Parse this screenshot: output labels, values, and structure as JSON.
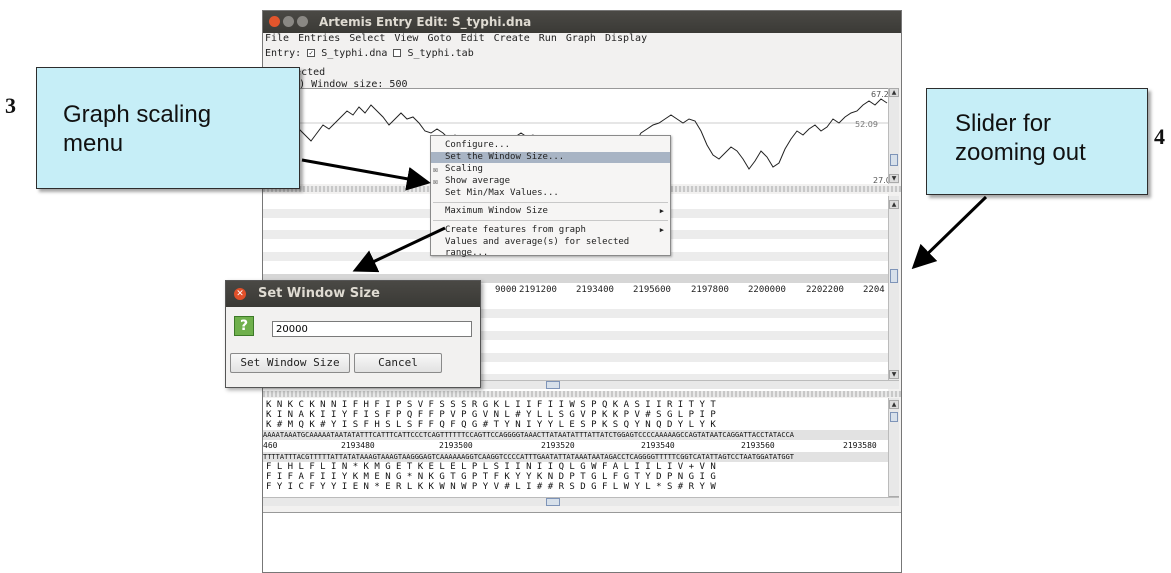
{
  "window": {
    "title": "Artemis Entry Edit: S_typhi.dna",
    "menus": [
      "File",
      "Entries",
      "Select",
      "View",
      "Goto",
      "Edit",
      "Create",
      "Run",
      "Graph",
      "Display"
    ],
    "entry_label": "Entry:",
    "entries": [
      {
        "name": "S_typhi.dna",
        "checked": true
      },
      {
        "name": "S_typhi.tab",
        "checked": false
      }
    ],
    "selection_info": "selected",
    "graph_label": "ent (%)  Window size: 500",
    "graph_values": {
      "max": "67.2",
      "avg": "52.09",
      "min": "27.0"
    },
    "ruler": [
      "9000",
      "2191200",
      "2193400",
      "2195600",
      "2197800",
      "2200000",
      "2202200",
      "2204"
    ],
    "seq_ruler": [
      "2193480",
      "2193500",
      "2193520",
      "2193540",
      "2193560",
      "2193580"
    ],
    "seq_ruler_left": "460",
    "frames_forward": [
      "K  N  K  C  K  N  N  I  F  H  F  I  P  S  V  F  S  S  S  R  G  K  L  I  I  F  I  I  W  S  P  Q  K  A  S  I  I  R  I  T  Y  T",
      " K  I  N  A  K  I  I  Y  F  I  S  F  P  Q  F  F  P  V  P  G  V  N  L  #  Y  L  L  S  G  V  P  K  K  P  V  #  S  G  L  P  I  P",
      "  K  #  M  Q  K  #  Y  I  S  F  H  S  L  S  F  F  Q  F  Q  G  #  T  Y  N  I  Y  Y  L  E  S  P  K  S  Q  Y  N  Q  D  Y  L  Y  K"
    ],
    "dna_forward": "AAAATAAATGCAAAAATAATATATTTCATTTCATTCCCTCAGTTTTTTCCAGTTCCAGGGGTAAACTTATAATATTTATTATCTGGAGTCCCCAAAAAGCCAGTATAATCAGGATTACCTATACCA",
    "dna_reverse": "TTTTATTTACGTTTTTATTATATAAAGTAAAGTAAGGGAGTCAAAAAAGGTCAAGGTCCCCATTTGAATATTATAAATAATAGACCTCAGGGGTTTTTCGGTCATATTAGTCCTAATGGATATGGT",
    "frames_reverse": [
      "   F  L  H  L  F  L  I  N  *  K  M  G  E  T  K  E  L  E  L  P  L  S  I  I  N  I  I  Q  L  G  W  F  A  L  I  I  L  I  V  +  V  N",
      "F  I  F  A  F  I  I  Y  K  M  E  N  G  *  N  K  G  T  G  P  T  F  K  Y  Y  K  N  D  P  T  G  L  F  G  T  Y  D  P  N  G  I  G",
      " F  Y  I  C  F  Y  Y  I  E  N  *  E  R  L  K  K  W  N  W  P  Y  V  #  L  I  #  #  R  S  D  G  F  L  W  Y  L  *  S  #  R  Y  W"
    ]
  },
  "popup_menu": {
    "items": [
      {
        "label": "Configure...",
        "check": "",
        "submenu": false,
        "highlighted": false
      },
      {
        "label": "Set the Window Size...",
        "check": "",
        "submenu": false,
        "highlighted": true
      },
      {
        "label": "Scaling",
        "check": "☒",
        "submenu": false,
        "highlighted": false
      },
      {
        "label": "Show average",
        "check": "☒",
        "submenu": false,
        "highlighted": false
      },
      {
        "label": "Set Min/Max Values...",
        "check": "",
        "submenu": false,
        "highlighted": false
      },
      {
        "label": "Maximum Window Size",
        "check": "",
        "submenu": true,
        "highlighted": false
      },
      {
        "label": "Create features from graph",
        "check": "",
        "submenu": true,
        "highlighted": false
      },
      {
        "label": "Values and average(s) for selected range...",
        "check": "",
        "submenu": false,
        "highlighted": false
      }
    ]
  },
  "dialog": {
    "title": "Set Window Size",
    "icon": "question-icon",
    "icon_glyph": "?",
    "input_value": "20000",
    "ok_label": "Set Window Size",
    "cancel_label": "Cancel"
  },
  "annotations": {
    "callout_left": {
      "number": "3",
      "text_line1": "Graph scaling",
      "text_line2": "menu"
    },
    "callout_right": {
      "number": "4",
      "text_line1": "Slider for",
      "text_line2": "zooming out"
    }
  },
  "colors": {
    "callout_bg": "#c6eef7",
    "menu_highlight": "#a8b4c4",
    "titlebar": "#3b3a36",
    "arrow": "#000000"
  }
}
